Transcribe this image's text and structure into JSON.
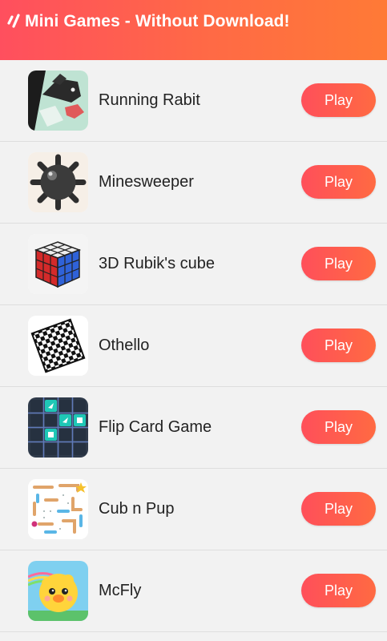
{
  "header": {
    "title": "Mini Games - Without Download!"
  },
  "colors": {
    "accent_start": "#ff4f5e",
    "accent_end": "#ff7a36",
    "background": "#f2f2f2"
  },
  "games": [
    {
      "name": "Running Rabit",
      "button": "Play",
      "icon": "running-rabit-icon"
    },
    {
      "name": "Minesweeper",
      "button": "Play",
      "icon": "minesweeper-icon"
    },
    {
      "name": "3D Rubik's cube",
      "button": "Play",
      "icon": "rubiks-cube-icon"
    },
    {
      "name": "Othello",
      "button": "Play",
      "icon": "othello-board-icon"
    },
    {
      "name": "Flip Card Game",
      "button": "Play",
      "icon": "flip-card-icon"
    },
    {
      "name": "Cub n Pup",
      "button": "Play",
      "icon": "cub-n-pup-icon"
    },
    {
      "name": "McFly",
      "button": "Play",
      "icon": "mcfly-bird-icon"
    }
  ]
}
